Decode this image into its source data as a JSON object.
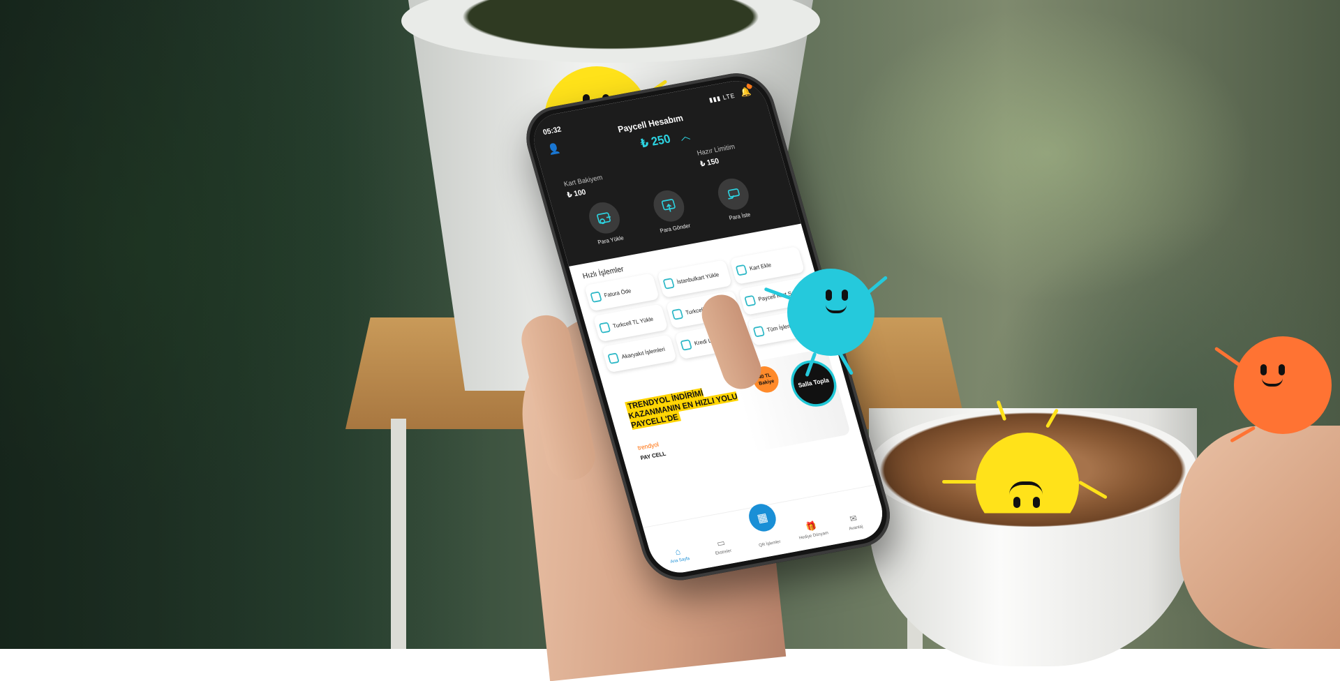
{
  "colors": {
    "accent_teal": "#2dd4e2",
    "app_dark": "#1c1c1c",
    "mascot_yellow": "#ffe21a",
    "mascot_blue": "#25c9dc",
    "mascot_orange": "#ff7333",
    "brand_blue": "#1a8fd6"
  },
  "status": {
    "time": "05:32",
    "network": "LTE"
  },
  "account": {
    "title": "Paycell Hesabım",
    "balance": "₺ 250",
    "card_balance_label": "Kart Bakiyem",
    "card_balance_value": "₺ 100",
    "limit_label": "Hazır Limitim",
    "limit_value": "₺ 150"
  },
  "actions": [
    {
      "label": "Para Yükle",
      "icon": "wallet-add-icon"
    },
    {
      "label": "Para Gönder",
      "icon": "send-money-icon"
    },
    {
      "label": "Para İste",
      "icon": "request-money-icon"
    }
  ],
  "quick": {
    "title": "Hızlı İşlemler",
    "tiles": [
      {
        "label": "Fatura Öde",
        "icon": "invoice-icon"
      },
      {
        "label": "İstanbulkart Yükle",
        "icon": "transit-card-icon"
      },
      {
        "label": "Kart Ekle",
        "icon": "add-card-icon"
      },
      {
        "label": "Turkcell TL Yükle",
        "icon": "topup-icon"
      },
      {
        "label": "Turkcell Paket Yükle",
        "icon": "package-icon"
      },
      {
        "label": "Paycell Kart Satın Al",
        "icon": "buy-card-icon"
      },
      {
        "label": "Akaryakıt İşlemleri",
        "icon": "fuel-icon"
      },
      {
        "label": "Kredi Limitini Öğ...",
        "icon": "credit-icon"
      },
      {
        "label": "Tüm İşlemler",
        "icon": "all-services-icon"
      }
    ]
  },
  "banner": {
    "headline": "TRENDYOL İNDİRİMİ KAZANMANIN EN HIZLI YOLU PAYCELL'DE",
    "brand": "trendyol",
    "logo_text": "PAY CELL",
    "badge": "40 TL Bakiye",
    "salla": "Salla Topla"
  },
  "tabs": [
    {
      "label": "Ana Sayfa",
      "icon": "home-icon",
      "active": true
    },
    {
      "label": "Ekstreler",
      "icon": "statement-icon",
      "active": false
    },
    {
      "label": "QR İşlemler",
      "icon": "qr-icon",
      "active": false
    },
    {
      "label": "Hediye Dünyam",
      "icon": "gift-icon",
      "active": false
    },
    {
      "label": "Avantaj",
      "icon": "ticket-icon",
      "active": false
    }
  ]
}
